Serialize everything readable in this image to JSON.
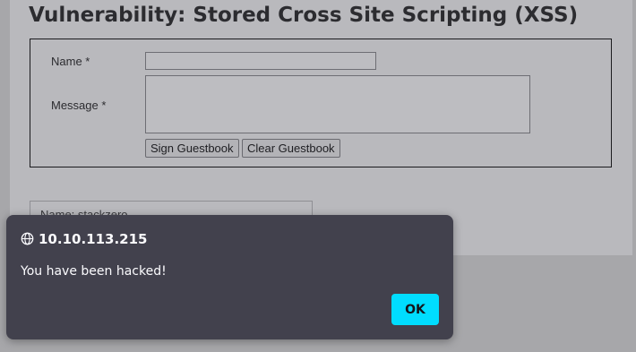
{
  "page": {
    "title": "Vulnerability: Stored Cross Site Scripting (XSS)"
  },
  "form": {
    "name_label": "Name *",
    "message_label": "Message *",
    "name_value": "",
    "message_value": "",
    "sign_button": "Sign Guestbook",
    "clear_button": "Clear Guestbook"
  },
  "entry": {
    "text": "Name: stackzero"
  },
  "alert": {
    "origin": "10.10.113.215",
    "message": "You have been hacked!",
    "ok_label": "OK",
    "icon": "globe-icon"
  },
  "colors": {
    "dialog_bg": "#42414d",
    "ok_button": "#00ddff",
    "overlay": "#a7a7aa"
  }
}
